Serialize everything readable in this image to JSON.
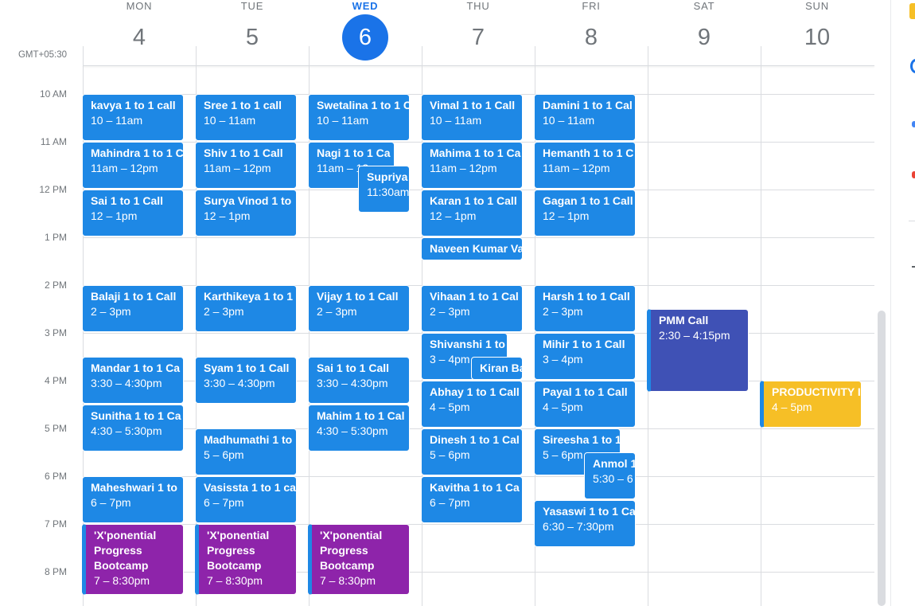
{
  "timezone": "GMT+05:30",
  "days": [
    {
      "name": "MON",
      "num": "4"
    },
    {
      "name": "TUE",
      "num": "5"
    },
    {
      "name": "WED",
      "num": "6"
    },
    {
      "name": "THU",
      "num": "7"
    },
    {
      "name": "FRI",
      "num": "8"
    },
    {
      "name": "SAT",
      "num": "9"
    },
    {
      "name": "SUN",
      "num": "10"
    }
  ],
  "hours": [
    "10 AM",
    "11 AM",
    "12 PM",
    "1 PM",
    "2 PM",
    "3 PM",
    "4 PM",
    "5 PM",
    "6 PM",
    "7 PM",
    "8 PM"
  ],
  "events": [
    {
      "title": "kavya 1 to 1 call",
      "time": "10 – 11am"
    },
    {
      "title": "Mahindra 1 to 1 C",
      "time": "11am – 12pm"
    },
    {
      "title": "Sai 1 to 1 Call",
      "time": "12 – 1pm"
    },
    {
      "title": "Balaji 1 to 1 Call",
      "time": "2 – 3pm"
    },
    {
      "title": "Mandar 1 to 1 Ca",
      "time": "3:30 – 4:30pm"
    },
    {
      "title": "Sunitha 1 to 1 Ca",
      "time": "4:30 – 5:30pm"
    },
    {
      "title": "Maheshwari 1 to",
      "time": "6 – 7pm"
    },
    {
      "title": "'X'ponential Progress Bootcamp",
      "time": "7 – 8:30pm"
    },
    {
      "title": "Sree 1 to 1 call",
      "time": "10 – 11am"
    },
    {
      "title": "Shiv 1 to 1 Call",
      "time": "11am – 12pm"
    },
    {
      "title": "Surya Vinod 1 to",
      "time": "12 – 1pm"
    },
    {
      "title": "Karthikeya 1 to 1",
      "time": "2 – 3pm"
    },
    {
      "title": "Syam 1 to 1 Call",
      "time": "3:30 – 4:30pm"
    },
    {
      "title": "Madhumathi 1 to",
      "time": "5 – 6pm"
    },
    {
      "title": "Vasissta 1 to 1 ca",
      "time": "6 – 7pm"
    },
    {
      "title": "'X'ponential Progress Bootcamp",
      "time": "7 – 8:30pm"
    },
    {
      "title": "Swetalina 1 to 1 C",
      "time": "10 – 11am"
    },
    {
      "title": "Nagi 1 to 1 Ca",
      "time": "11am – 12"
    },
    {
      "title": "Supriya",
      "time": "11:30am"
    },
    {
      "title": "Vijay 1 to 1 Call",
      "time": "2 – 3pm"
    },
    {
      "title": "Sai 1 to 1 Call",
      "time": "3:30 – 4:30pm"
    },
    {
      "title": "Mahim 1 to 1 Cal",
      "time": "4:30 – 5:30pm"
    },
    {
      "title": "'X'ponential Progress Bootcamp",
      "time": "7 – 8:30pm"
    },
    {
      "title": "Vimal 1 to 1 Call",
      "time": "10 – 11am"
    },
    {
      "title": "Mahima 1 to 1 Ca",
      "time": "11am – 12pm"
    },
    {
      "title": "Karan 1 to 1 Call",
      "time": "12 – 1pm"
    },
    {
      "title": "Naveen Kumar Va",
      "time": ""
    },
    {
      "title": "Vihaan 1 to 1 Cal",
      "time": "2 – 3pm"
    },
    {
      "title": "Shivanshi 1 to",
      "time": "3 – 4pm"
    },
    {
      "title": "Kiran Ba",
      "time": ""
    },
    {
      "title": "Abhay 1 to 1 Call",
      "time": "4 – 5pm"
    },
    {
      "title": "Dinesh 1 to 1 Cal",
      "time": "5 – 6pm"
    },
    {
      "title": "Kavitha 1 to 1 Ca",
      "time": "6 – 7pm"
    },
    {
      "title": "Damini 1 to 1 Cal",
      "time": "10 – 11am"
    },
    {
      "title": "Hemanth 1 to 1 C",
      "time": "11am – 12pm"
    },
    {
      "title": "Gagan 1 to 1 Call",
      "time": "12 – 1pm"
    },
    {
      "title": "Harsh 1 to 1 Call",
      "time": "2 – 3pm"
    },
    {
      "title": "Mihir 1 to 1 Call",
      "time": "3 – 4pm"
    },
    {
      "title": "Payal 1 to 1 Call",
      "time": "4 – 5pm"
    },
    {
      "title": "Sireesha 1 to 1",
      "time": "5 – 6pm"
    },
    {
      "title": "Anmol 1",
      "time": "5:30 – 6"
    },
    {
      "title": "Yasaswi 1 to 1 Ca",
      "time": "6:30 – 7:30pm"
    },
    {
      "title": "PMM Call",
      "time": "2:30 – 4:15pm"
    },
    {
      "title": "PRODUCTIVITY II",
      "time": "4 – 5pm"
    }
  ],
  "colors": {
    "today": "#1a73e8",
    "event_blue": "#1e88e5",
    "event_purple": "#8e24aa",
    "event_indigo": "#3f51b5",
    "event_yellow": "#f6bf26"
  }
}
